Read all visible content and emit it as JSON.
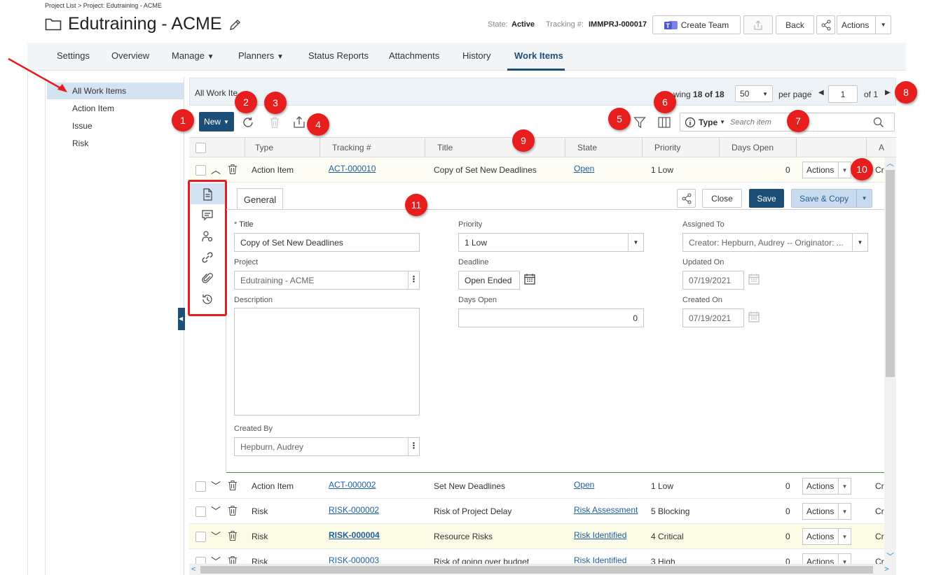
{
  "header": {
    "breadcrumb": "Project List > Project: Edutraining - ACME",
    "title": "Edutraining - ACME",
    "state_label": "State:",
    "state_value": "Active",
    "tracking_label": "Tracking #:",
    "tracking_value": "IMMPRJ-000017",
    "create_team_label": "Create Team",
    "back_label": "Back",
    "actions_label": "Actions",
    "teams_color": "#5059c9"
  },
  "tabs": [
    {
      "label": "Settings"
    },
    {
      "label": "Overview"
    },
    {
      "label": "Manage"
    },
    {
      "label": "Planners"
    },
    {
      "label": "Status Reports"
    },
    {
      "label": "Attachments"
    },
    {
      "label": "History"
    },
    {
      "label": "Work Items"
    }
  ],
  "sidebar": {
    "items": [
      {
        "label": "All Work Items"
      },
      {
        "label": "Action Item"
      },
      {
        "label": "Issue"
      },
      {
        "label": "Risk"
      }
    ]
  },
  "panel": {
    "title": "All Work Ite",
    "showing_prefix": "wing",
    "showing_count": "18 of 18",
    "per_page_value": "50",
    "per_page_label": "per page",
    "page_value": "1",
    "page_of": "of 1",
    "new_label": "New",
    "type_filter_label": "Type",
    "search_placeholder": "Search item"
  },
  "columns": [
    "Type",
    "Tracking #",
    "Title",
    "State",
    "Priority",
    "Days Open",
    "",
    "A"
  ],
  "rows": [
    {
      "type": "Action Item",
      "tracking": "ACT-000010",
      "title": "Copy of Set New Deadlines",
      "state": "Open",
      "priority": "1 Low",
      "days": "0",
      "actions": "Actions",
      "extra": "Cr"
    },
    {
      "type": "Action Item",
      "tracking": "ACT-000002",
      "title": "Set New Deadlines",
      "state": "Open",
      "priority": "1 Low",
      "days": "0",
      "actions": "Actions",
      "extra": "Cr"
    },
    {
      "type": "Risk",
      "tracking": "RISK-000002",
      "title": "Risk of Project Delay",
      "state": "Risk Assessment",
      "priority": "5 Blocking",
      "days": "0",
      "actions": "Actions",
      "extra": "Cr"
    },
    {
      "type": "Risk",
      "tracking": "RISK-000004",
      "title": "Resource Risks",
      "state": "Risk Identified",
      "priority": "4 Critical",
      "days": "0",
      "actions": "Actions",
      "extra": "Cr"
    },
    {
      "type": "Risk",
      "tracking": "RISK-000003",
      "title": "Risk of going over budget",
      "state": "Risk Identified",
      "priority": "3 High",
      "days": "0",
      "actions": "Actions",
      "extra": "Cr"
    }
  ],
  "detail": {
    "tab_general": "General",
    "close_label": "Close",
    "save_label": "Save",
    "save_copy_label": "Save & Copy",
    "required_mark": "*",
    "title_label": "Title",
    "title_value": "Copy of Set New Deadlines",
    "project_label": "Project",
    "project_value": "Edutraining - ACME",
    "description_label": "Description",
    "created_by_label": "Created By",
    "created_by_value": "Hepburn, Audrey",
    "priority_label": "Priority",
    "priority_value": "1 Low",
    "deadline_label": "Deadline",
    "deadline_value": "Open Ended",
    "days_open_label": "Days Open",
    "days_open_value": "0",
    "assigned_to_label": "Assigned To",
    "assigned_to_value": "Creator: Hepburn, Audrey -- Originator: ...",
    "updated_on_label": "Updated On",
    "updated_on_value": "07/19/2021",
    "created_on_label": "Created On",
    "created_on_value": "07/19/2021"
  },
  "badges": [
    "1",
    "2",
    "3",
    "4",
    "5",
    "6",
    "7",
    "8",
    "9",
    "10",
    "11"
  ],
  "colors": {
    "accent": "#1d4f76",
    "save_button": "#1d4f76",
    "link": "#1d5fa0",
    "annotation_red": "#e61e1e",
    "selected_bg": "#d3e3f1"
  }
}
